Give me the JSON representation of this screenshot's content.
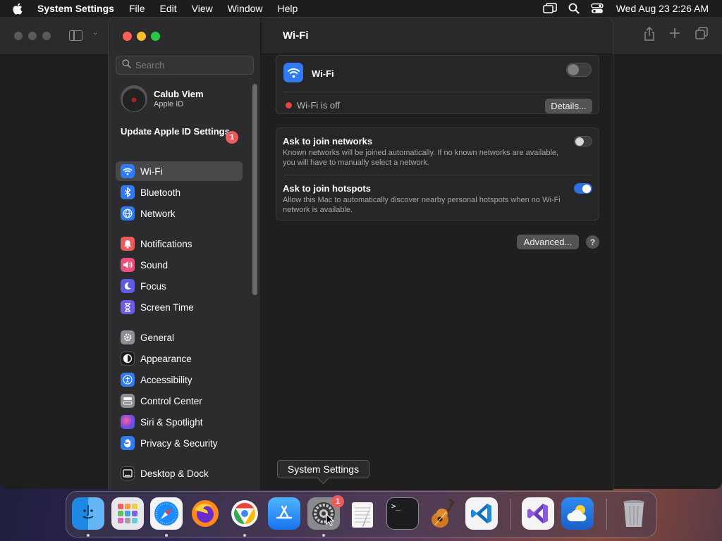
{
  "menubar": {
    "app_name": "System Settings",
    "menus": [
      "File",
      "Edit",
      "View",
      "Window",
      "Help"
    ],
    "clock": "Wed Aug 23  2:26 AM"
  },
  "sidebar": {
    "search_placeholder": "Search",
    "account": {
      "name": "Calub Viem",
      "subtitle": "Apple ID"
    },
    "update_label": "Update Apple ID Settings",
    "update_badge": "1",
    "items": [
      {
        "label": "Wi-Fi",
        "icon": "wifi-icon",
        "color": "#2f7bf5",
        "selected": true
      },
      {
        "label": "Bluetooth",
        "icon": "bluetooth-icon",
        "color": "#2f7bf5"
      },
      {
        "label": "Network",
        "icon": "globe-icon",
        "color": "#2f7bf5"
      },
      {
        "label": "Notifications",
        "icon": "bell-icon",
        "color": "#ec5b5b"
      },
      {
        "label": "Sound",
        "icon": "speaker-icon",
        "color": "#ec4f7c"
      },
      {
        "label": "Focus",
        "icon": "moon-icon",
        "color": "#5e5ce6"
      },
      {
        "label": "Screen Time",
        "icon": "hourglass-icon",
        "color": "#6d5ce6"
      },
      {
        "label": "General",
        "icon": "gear-icon",
        "color": "#8e8e93"
      },
      {
        "label": "Appearance",
        "icon": "appearance-icon",
        "color": "#1c1c1e"
      },
      {
        "label": "Accessibility",
        "icon": "accessibility-icon",
        "color": "#2f7bf5"
      },
      {
        "label": "Control Center",
        "icon": "control-center-icon",
        "color": "#8e8e93"
      },
      {
        "label": "Siri & Spotlight",
        "icon": "siri-icon",
        "color": "#b04ad0"
      },
      {
        "label": "Privacy & Security",
        "icon": "hand-icon",
        "color": "#2f7bf5"
      },
      {
        "label": "Desktop & Dock",
        "icon": "desktop-icon",
        "color": "#1c1c1e"
      }
    ]
  },
  "main": {
    "title": "Wi-Fi",
    "wifi_label": "Wi-Fi",
    "wifi_status": "Wi-Fi is off",
    "details_label": "Details...",
    "ask_networks": {
      "title": "Ask to join networks",
      "desc": "Known networks will be joined automatically. If no known networks are available, you will have to manually select a network."
    },
    "ask_hotspots": {
      "title": "Ask to join hotspots",
      "desc": "Allow this Mac to automatically discover nearby personal hotspots when no Wi-Fi network is available."
    },
    "advanced_label": "Advanced...",
    "help_label": "?"
  },
  "tooltip": "System Settings",
  "dock": {
    "settings_badge": "1",
    "terminal_prompt": ">_"
  },
  "colors": {
    "accent": "#2f6fe4",
    "status_off": "#ec4141"
  }
}
